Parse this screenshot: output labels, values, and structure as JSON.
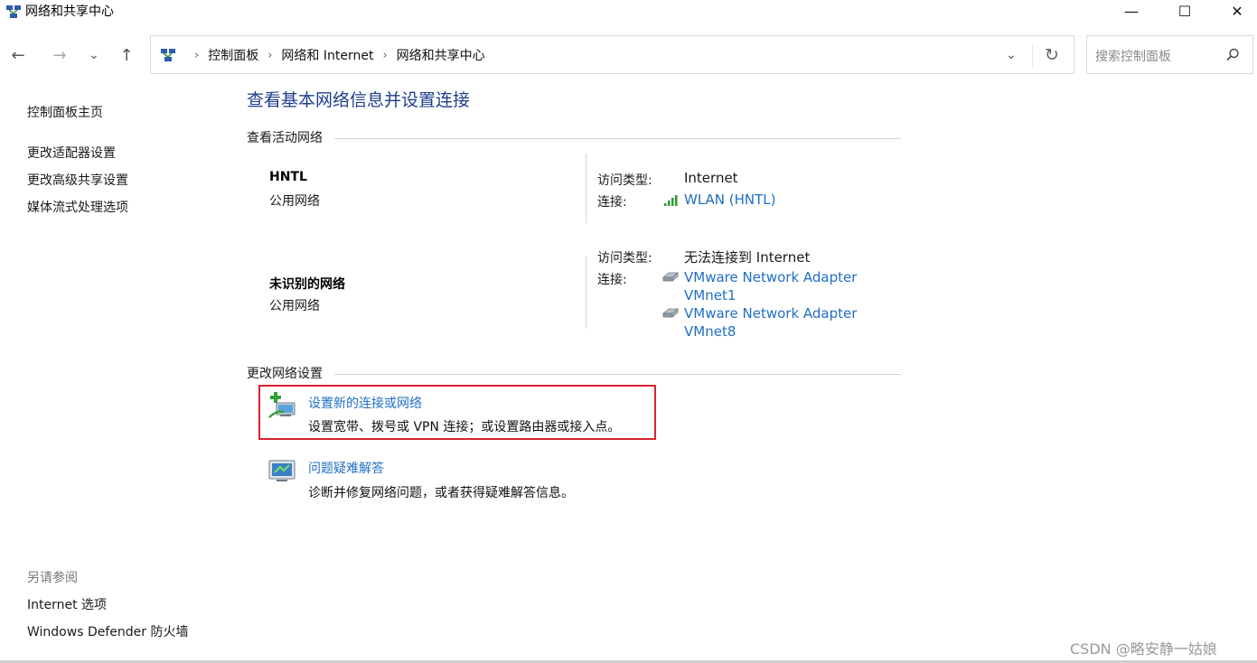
{
  "window": {
    "title": "网络和共享中心",
    "minimize_glyph": "—",
    "maximize_glyph": "☐",
    "close_glyph": "✕",
    "icon": "network-sharing-icon"
  },
  "nav": {
    "back_glyph": "←",
    "forward_glyph": "→",
    "recent_glyph": "⌄",
    "up_glyph": "↑",
    "breadcrumbs": [
      "控制面板",
      "网络和 Internet",
      "网络和共享中心"
    ],
    "separator": "›",
    "dropdown_glyph": "⌄",
    "refresh_glyph": "↻",
    "search_placeholder": "搜索控制面板"
  },
  "sidebar": {
    "home": "控制面板主页",
    "links": [
      "更改适配器设置",
      "更改高级共享设置",
      "媒体流式处理选项"
    ],
    "see_also_heading": "另请参阅",
    "see_also": [
      "Internet 选项",
      "Windows Defender 防火墙"
    ]
  },
  "main": {
    "title": "查看基本网络信息并设置连接",
    "active_heading": "查看活动网络",
    "networks": [
      {
        "name": "HNTL",
        "type": "公用网络",
        "access_label": "访问类型:",
        "access_value": "Internet",
        "connection_label": "连接:",
        "connection_icon": "wifi-signal-icon",
        "connections": [
          "WLAN (HNTL)"
        ]
      },
      {
        "name": "未识别的网络",
        "type": "公用网络",
        "access_label": "访问类型:",
        "access_value": "无法连接到 Internet",
        "connection_label": "连接:",
        "connection_icon": "ethernet-adapter-icon",
        "connections": [
          {
            "line1": "VMware Network Adapter",
            "line2": "VMnet1"
          },
          {
            "line1": "VMware Network Adapter",
            "line2": "VMnet8"
          }
        ]
      }
    ],
    "change_heading": "更改网络设置",
    "tasks": [
      {
        "title": "设置新的连接或网络",
        "desc": "设置宽带、拨号或 VPN 连接；或设置路由器或接入点。",
        "icon": "new-connection-icon"
      },
      {
        "title": "问题疑难解答",
        "desc": "诊断并修复网络问题，或者获得疑难解答信息。",
        "icon": "troubleshoot-icon"
      }
    ]
  },
  "watermark": "CSDN @略安静一姑娘",
  "colors": {
    "link": "#1f6fc4",
    "title": "#1e3f8c",
    "highlight": "#d9232d"
  }
}
